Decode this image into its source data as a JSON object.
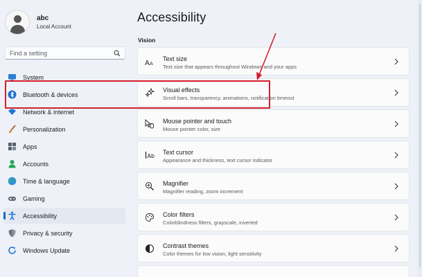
{
  "profile": {
    "name": "abc",
    "subtitle": "Local Account"
  },
  "search": {
    "placeholder": "Find a setting"
  },
  "nav": {
    "items": [
      {
        "label": "System",
        "icon": "system-icon"
      },
      {
        "label": "Bluetooth & devices",
        "icon": "bluetooth-icon"
      },
      {
        "label": "Network & internet",
        "icon": "wifi-icon"
      },
      {
        "label": "Personalization",
        "icon": "brush-icon"
      },
      {
        "label": "Apps",
        "icon": "apps-icon"
      },
      {
        "label": "Accounts",
        "icon": "person-icon"
      },
      {
        "label": "Time & language",
        "icon": "globe-icon"
      },
      {
        "label": "Gaming",
        "icon": "gamepad-icon"
      },
      {
        "label": "Accessibility",
        "icon": "accessibility-icon",
        "active": true
      },
      {
        "label": "Privacy & security",
        "icon": "shield-icon"
      },
      {
        "label": "Windows Update",
        "icon": "update-icon"
      }
    ],
    "accent": "#1467c3"
  },
  "main": {
    "title": "Accessibility",
    "section": "Vision",
    "cards": [
      {
        "title": "Text size",
        "desc": "Text size that appears throughout Windows and your apps",
        "icon": "text-size-icon"
      },
      {
        "title": "Visual effects",
        "desc": "Scroll bars, transparency, animations, notification timeout",
        "icon": "visual-effects-icon",
        "highlighted": true
      },
      {
        "title": "Mouse pointer and touch",
        "desc": "Mouse pointer color, size",
        "icon": "mouse-pointer-icon"
      },
      {
        "title": "Text cursor",
        "desc": "Appearance and thickness, text cursor indicator",
        "icon": "text-cursor-icon"
      },
      {
        "title": "Magnifier",
        "desc": "Magnifier reading, zoom increment",
        "icon": "magnifier-icon"
      },
      {
        "title": "Color filters",
        "desc": "Colorblindness filters, grayscale, inverted",
        "icon": "color-filters-icon"
      },
      {
        "title": "Contrast themes",
        "desc": "Color themes for low vision, light sensitivity",
        "icon": "contrast-icon"
      }
    ]
  },
  "annotation": {
    "color": "#d21f2c"
  }
}
